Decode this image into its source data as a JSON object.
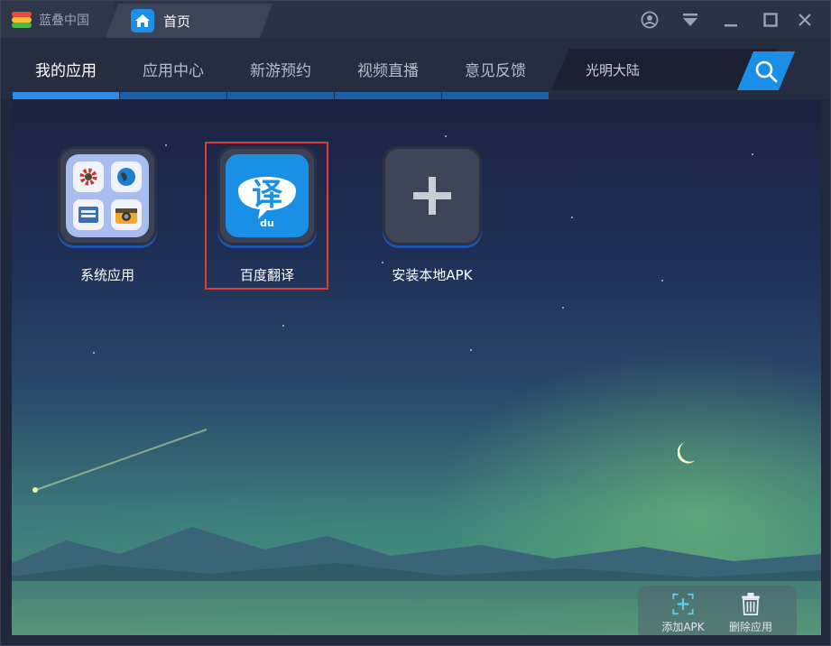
{
  "titlebar": {
    "brand": "蓝叠中国",
    "home_tab": "首页"
  },
  "nav": {
    "tabs": [
      {
        "label": "我的应用"
      },
      {
        "label": "应用中心"
      },
      {
        "label": "新游预约"
      },
      {
        "label": "视频直播"
      },
      {
        "label": "意见反馈"
      }
    ],
    "active_index": 0
  },
  "search": {
    "value": "光明大陆"
  },
  "apps": [
    {
      "label": "系统应用",
      "icon": "system-apps-folder-icon"
    },
    {
      "label": "百度翻译",
      "icon": "baidu-translate-icon",
      "glyph": "译",
      "paw": "du"
    },
    {
      "label": "安装本地APK",
      "icon": "plus-icon"
    }
  ],
  "bottom_actions": {
    "add_apk": "添加APK",
    "delete_app": "删除应用"
  },
  "colors": {
    "accent": "#1b8fe8",
    "active_tab_bar": "#2a8ce6",
    "tab_bar": "#1b5fa8",
    "highlight": "#e23a3a"
  }
}
